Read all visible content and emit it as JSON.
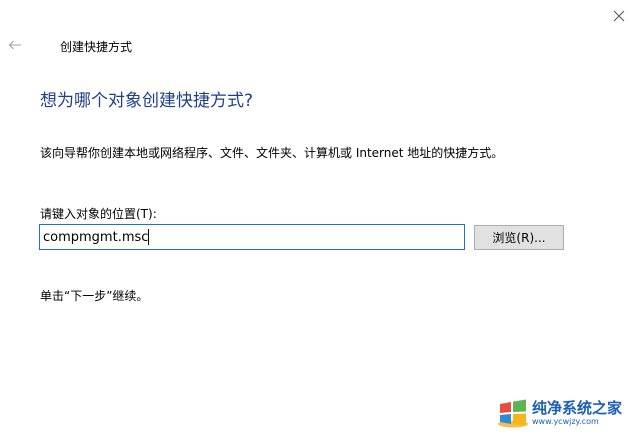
{
  "window": {
    "title": "创建快捷方式"
  },
  "icons": {
    "close": "close-icon",
    "back": "back-arrow-icon"
  },
  "wizard": {
    "heading": "想为哪个对象创建快捷方式?",
    "description": "该向导帮你创建本地或网络程序、文件、文件夹、计算机或 Internet 地址的快捷方式。",
    "location_label": "请键入对象的位置(T):",
    "location_value": "compmgmt.msc",
    "browse_label": "浏览(R)...",
    "next_hint": "单击“下一步”继续。"
  },
  "watermark": {
    "name": "纯净系统之家",
    "url": "www.ycwjzy.com"
  },
  "colors": {
    "heading": "#1f3e8c",
    "input_border_focus": "#1f6fd0",
    "button_bg": "#e1e1e1",
    "watermark": "#1a5fb4"
  }
}
